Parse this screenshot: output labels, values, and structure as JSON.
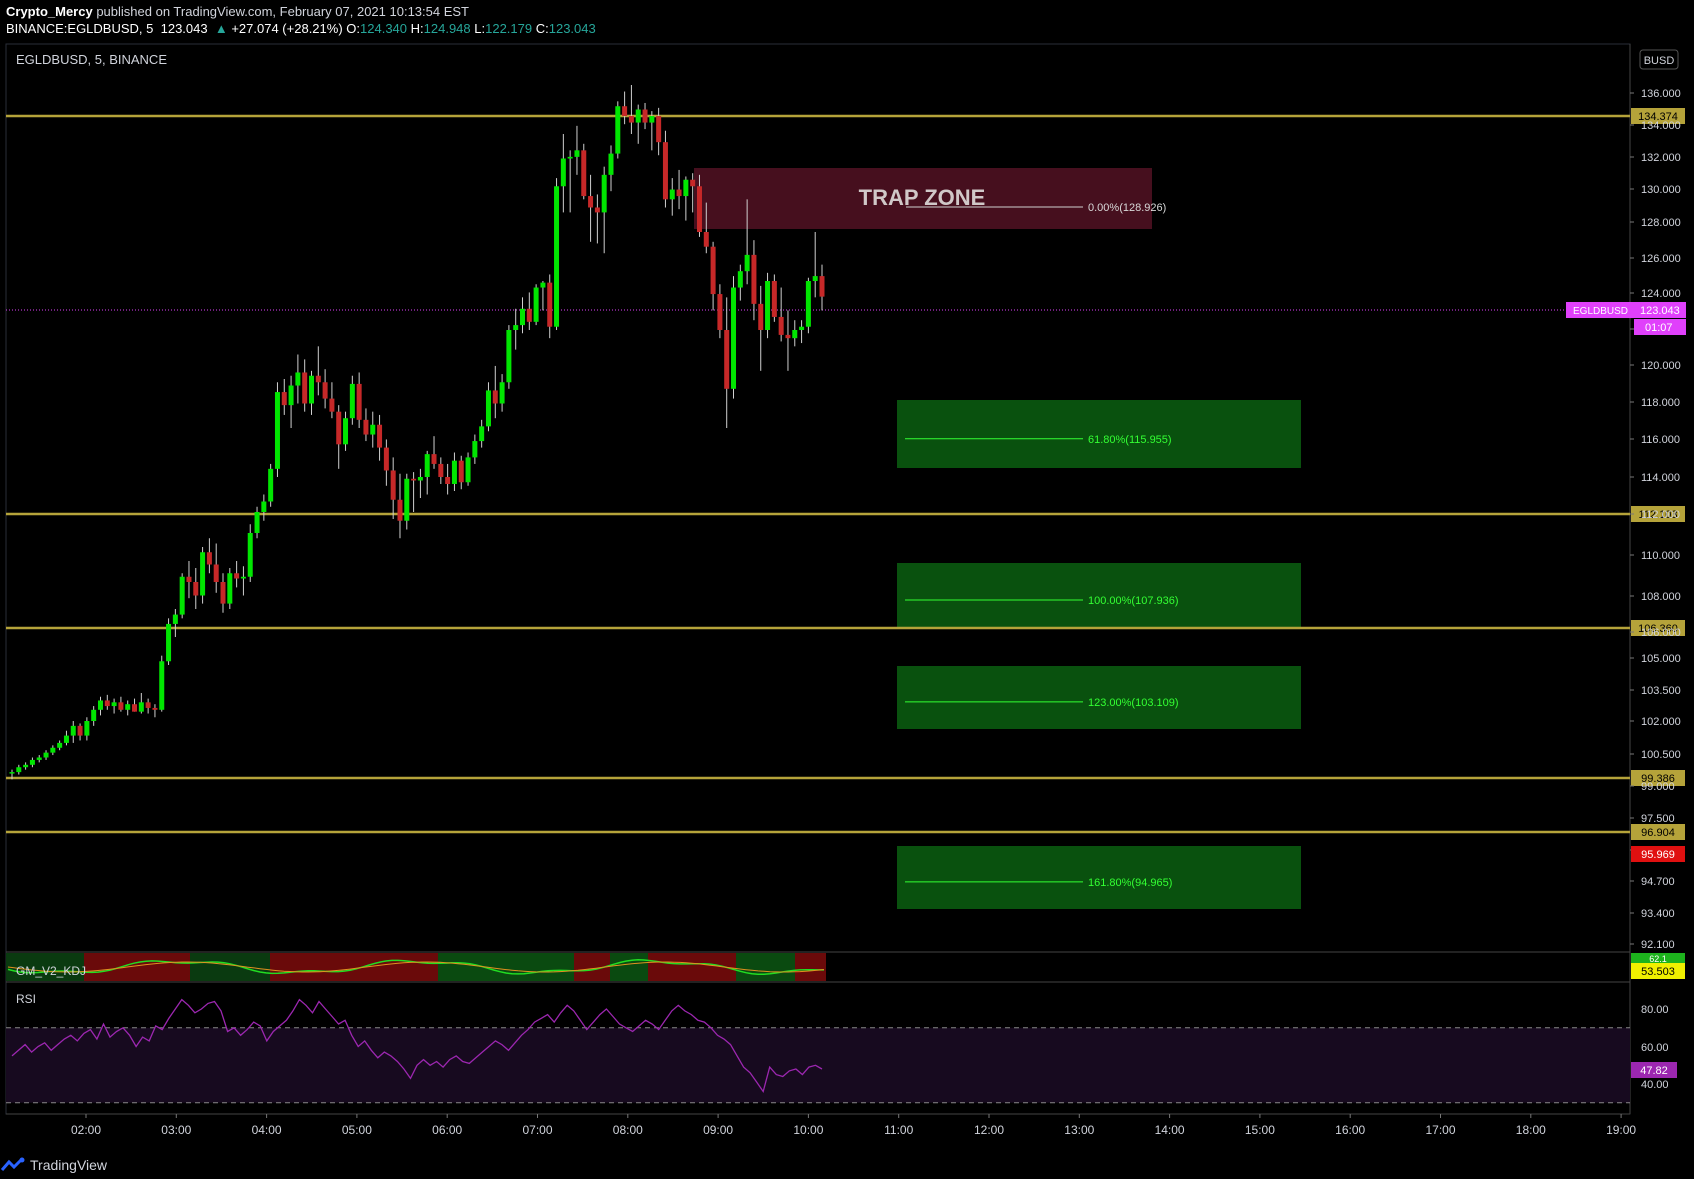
{
  "header": {
    "author": "Crypto_Mercy",
    "published_text": "published on TradingView.com, February 07, 2021 10:13:54 EST",
    "symbol_line": "BINANCE:EGLDBUSD, 5",
    "last": "123.043",
    "change": "+27.074 (+28.21%)",
    "o_label": "O:",
    "o_val": "124.340",
    "h_label": "H:",
    "h_val": "124.948",
    "l_label": "L:",
    "l_val": "122.179",
    "c_label": "C:",
    "c_val": "123.043"
  },
  "pane_title": "EGLDBUSD, 5, BINANCE",
  "currency_button": "BUSD",
  "footer": {
    "brand": "TradingView",
    "logo_icon": "tradingview-logo-icon"
  },
  "colors": {
    "background": "#000000",
    "up": "#00e600",
    "down": "#c62828",
    "level_line": "#b5a33a",
    "trap_zone": "#4a1020",
    "target_zone": "#0a5a10",
    "rsi": "#9c27b0",
    "last_price": "#e040fb"
  },
  "chart_data": [
    {
      "type": "candlestick",
      "title": "EGLDBUSD, 5, BINANCE",
      "x_ticks": [
        "02:00",
        "03:00",
        "04:00",
        "05:00",
        "06:00",
        "07:00",
        "08:00",
        "09:00",
        "10:00",
        "11:00",
        "12:00",
        "13:00",
        "14:00",
        "15:00",
        "16:00",
        "17:00",
        "18:00",
        "19:00"
      ],
      "y_ticks": [
        "136.000",
        "134.000",
        "132.000",
        "130.000",
        "128.000",
        "126.000",
        "124.000",
        "122.000",
        "120.000",
        "118.000",
        "116.000",
        "114.000",
        "112.000",
        "110.000",
        "108.000",
        "106.000",
        "105.000",
        "103.500",
        "102.000",
        "100.500",
        "99.000",
        "97.500",
        "96.000",
        "94.700",
        "93.400",
        "92.100"
      ],
      "last_price": {
        "label": "EGLDBUSD",
        "value": "123.043",
        "countdown": "01:07"
      },
      "horizontal_levels": [
        "134.374",
        "112.103",
        "106.360",
        "99.386",
        "96.904"
      ],
      "price_badge_red": "95.969",
      "zones": [
        {
          "name": "TRAP ZONE",
          "fib_label": "0.00%(128.926)",
          "kind": "trap"
        },
        {
          "fib_label": "61.80%(115.955)",
          "kind": "target"
        },
        {
          "fib_label": "100.00%(107.936)",
          "kind": "target"
        },
        {
          "fib_label": "123.00%(103.109)",
          "kind": "target"
        },
        {
          "fib_label": "161.80%(94.965)",
          "kind": "target"
        }
      ],
      "candles_approx": [
        [
          96.9,
          97.0,
          96.6,
          96.9
        ],
        [
          96.9,
          97.2,
          96.8,
          97.1
        ],
        [
          97.1,
          97.3,
          97.0,
          97.2
        ],
        [
          97.2,
          97.5,
          97.1,
          97.4
        ],
        [
          97.4,
          97.6,
          97.3,
          97.5
        ],
        [
          97.5,
          97.8,
          97.4,
          97.7
        ],
        [
          97.7,
          98.0,
          97.6,
          97.9
        ],
        [
          97.9,
          98.2,
          97.8,
          98.1
        ],
        [
          98.1,
          98.6,
          98.0,
          98.4
        ],
        [
          98.4,
          99.0,
          98.1,
          98.8
        ],
        [
          98.8,
          98.9,
          98.2,
          98.4
        ],
        [
          98.4,
          99.2,
          98.2,
          99.0
        ],
        [
          99.0,
          99.8,
          98.8,
          99.6
        ],
        [
          99.6,
          100.3,
          99.3,
          100.1
        ],
        [
          100.1,
          100.4,
          99.6,
          99.8
        ],
        [
          99.8,
          100.2,
          99.4,
          100.0
        ],
        [
          100.0,
          100.3,
          99.5,
          99.6
        ],
        [
          99.6,
          100.1,
          99.3,
          99.9
        ],
        [
          99.9,
          100.2,
          99.5,
          99.5
        ],
        [
          99.5,
          100.5,
          99.4,
          100.0
        ],
        [
          100.0,
          100.2,
          99.4,
          99.7
        ],
        [
          99.7,
          99.9,
          99.2,
          99.6
        ],
        [
          99.6,
          102.5,
          99.5,
          102.2
        ],
        [
          102.2,
          104.5,
          102.0,
          104.2
        ],
        [
          104.2,
          105.0,
          103.5,
          104.7
        ],
        [
          104.7,
          106.5,
          104.5,
          106.3
        ],
        [
          106.3,
          107.2,
          105.4,
          106.0
        ],
        [
          106.0,
          106.8,
          105.0,
          105.5
        ],
        [
          105.5,
          108.0,
          105.2,
          107.7
        ],
        [
          107.7,
          108.5,
          106.5,
          107.0
        ],
        [
          107.0,
          108.2,
          105.6,
          106.0
        ],
        [
          106.0,
          106.5,
          104.8,
          105.2
        ],
        [
          105.2,
          106.8,
          105.0,
          106.5
        ],
        [
          106.5,
          107.2,
          105.8,
          106.2
        ],
        [
          106.2,
          106.9,
          105.5,
          106.3
        ],
        [
          106.3,
          109.3,
          106.0,
          108.8
        ],
        [
          108.8,
          110.3,
          108.5,
          110.0
        ],
        [
          110.0,
          111.0,
          109.5,
          110.6
        ],
        [
          110.6,
          112.8,
          110.3,
          112.5
        ],
        [
          112.5,
          117.8,
          112.0,
          117.2
        ],
        [
          117.2,
          118.0,
          115.8,
          116.4
        ],
        [
          116.4,
          118.2,
          115.0,
          117.6
        ],
        [
          117.6,
          119.5,
          116.5,
          118.4
        ],
        [
          118.4,
          119.2,
          116.0,
          116.5
        ],
        [
          116.5,
          118.5,
          115.8,
          118.2
        ],
        [
          118.2,
          120.0,
          117.0,
          117.8
        ],
        [
          117.8,
          118.6,
          116.2,
          116.8
        ],
        [
          116.8,
          117.8,
          115.6,
          116.0
        ],
        [
          116.0,
          116.4,
          112.5,
          114.0
        ],
        [
          114.0,
          116.0,
          113.6,
          115.6
        ],
        [
          115.6,
          118.2,
          115.2,
          117.7
        ],
        [
          117.7,
          118.4,
          115.0,
          115.5
        ],
        [
          115.5,
          116.2,
          114.2,
          114.6
        ],
        [
          114.6,
          116.0,
          113.8,
          115.2
        ],
        [
          115.2,
          115.8,
          113.0,
          113.8
        ],
        [
          113.8,
          114.3,
          111.5,
          112.4
        ],
        [
          112.4,
          113.2,
          109.6,
          110.7
        ],
        [
          110.7,
          112.2,
          108.5,
          109.5
        ],
        [
          109.5,
          112.2,
          109.0,
          111.9
        ],
        [
          111.9,
          112.3,
          110.0,
          111.8
        ],
        [
          111.8,
          112.5,
          110.8,
          112.0
        ],
        [
          112.0,
          113.6,
          111.0,
          113.4
        ],
        [
          113.4,
          114.5,
          112.5,
          112.8
        ],
        [
          112.8,
          113.2,
          111.6,
          112.0
        ],
        [
          112.0,
          112.8,
          111.0,
          111.6
        ],
        [
          111.6,
          113.5,
          111.2,
          113.0
        ],
        [
          113.0,
          113.3,
          111.3,
          111.7
        ],
        [
          111.7,
          113.5,
          111.5,
          113.2
        ],
        [
          113.2,
          114.6,
          112.8,
          114.2
        ],
        [
          114.2,
          115.5,
          113.8,
          115.1
        ],
        [
          115.1,
          117.8,
          114.8,
          117.3
        ],
        [
          117.3,
          118.8,
          115.6,
          116.5
        ],
        [
          116.5,
          118.3,
          116.0,
          117.8
        ],
        [
          117.8,
          121.3,
          117.4,
          121.0
        ],
        [
          121.0,
          122.3,
          119.8,
          121.3
        ],
        [
          121.3,
          123.0,
          120.8,
          122.3
        ],
        [
          122.3,
          123.3,
          121.0,
          121.5
        ],
        [
          121.5,
          123.8,
          121.3,
          123.6
        ],
        [
          123.6,
          124.0,
          122.2,
          123.9
        ],
        [
          123.9,
          124.4,
          120.5,
          121.2
        ],
        [
          121.2,
          130.3,
          121.0,
          129.8
        ],
        [
          129.8,
          133.0,
          128.2,
          131.5
        ],
        [
          131.5,
          132.0,
          128.2,
          131.6
        ],
        [
          131.6,
          133.5,
          130.5,
          132.0
        ],
        [
          132.0,
          132.4,
          129.0,
          129.2
        ],
        [
          129.2,
          130.5,
          126.4,
          128.5
        ],
        [
          128.5,
          129.3,
          126.3,
          128.2
        ],
        [
          128.2,
          131.0,
          125.7,
          130.5
        ],
        [
          130.5,
          132.3,
          129.5,
          131.8
        ],
        [
          131.8,
          135.0,
          131.5,
          134.7
        ],
        [
          134.7,
          135.6,
          133.6,
          134.1
        ],
        [
          134.1,
          136.0,
          133.0,
          133.7
        ],
        [
          133.7,
          134.8,
          132.4,
          134.5
        ],
        [
          134.5,
          134.9,
          133.3,
          133.7
        ],
        [
          133.7,
          134.4,
          132.0,
          134.1
        ],
        [
          134.1,
          134.6,
          131.7,
          132.5
        ],
        [
          132.5,
          133.2,
          128.5,
          129.0
        ],
        [
          129.0,
          130.3,
          128.0,
          129.6
        ],
        [
          129.6,
          130.8,
          128.4,
          129.2
        ],
        [
          129.2,
          130.4,
          127.7,
          130.2
        ],
        [
          130.2,
          130.6,
          128.2,
          129.8
        ],
        [
          129.8,
          130.5,
          126.7,
          127.0
        ],
        [
          127.0,
          128.8,
          125.7,
          126.1
        ],
        [
          126.1,
          126.4,
          122.2,
          123.2
        ],
        [
          123.2,
          123.8,
          120.5,
          121.0
        ],
        [
          121.0,
          123.0,
          115.0,
          117.4
        ],
        [
          117.4,
          124.3,
          116.8,
          123.6
        ],
        [
          123.6,
          125.0,
          122.8,
          124.6
        ],
        [
          124.6,
          129.0,
          123.8,
          125.6
        ],
        [
          125.6,
          126.5,
          121.6,
          122.6
        ],
        [
          122.6,
          123.7,
          118.5,
          121.0
        ],
        [
          121.0,
          124.5,
          120.5,
          124.0
        ],
        [
          124.0,
          124.4,
          121.5,
          121.8
        ],
        [
          121.8,
          123.6,
          120.3,
          120.7
        ],
        [
          120.7,
          122.2,
          118.5,
          120.5
        ],
        [
          120.5,
          121.6,
          120.0,
          121.0
        ],
        [
          121.0,
          121.6,
          120.2,
          121.2
        ],
        [
          121.2,
          124.2,
          120.8,
          124.0
        ],
        [
          124.0,
          127.0,
          123.0,
          124.3
        ],
        [
          124.3,
          125.0,
          122.2,
          123.043
        ]
      ]
    },
    {
      "type": "line",
      "title": "GM_V2_KDJ",
      "value_badge": "53.503",
      "top_badge": "62.1"
    },
    {
      "type": "line",
      "title": "RSI",
      "y_ticks": [
        "80.00",
        "60.00",
        "40.00"
      ],
      "value_badge": "47.82",
      "series_approx": [
        55,
        58,
        61,
        57,
        60,
        62,
        58,
        61,
        64,
        66,
        63,
        67,
        69,
        64,
        72,
        65,
        68,
        70,
        66,
        60,
        65,
        63,
        71,
        69,
        75,
        80,
        85,
        82,
        78,
        80,
        83,
        84,
        79,
        68,
        70,
        66,
        69,
        73,
        71,
        63,
        68,
        71,
        74,
        79,
        85,
        82,
        78,
        84,
        80,
        76,
        72,
        74,
        66,
        60,
        63,
        58,
        54,
        57,
        55,
        52,
        48,
        43,
        50,
        53,
        50,
        52,
        49,
        53,
        55,
        52,
        51,
        54,
        57,
        60,
        63,
        61,
        58,
        62,
        66,
        69,
        73,
        75,
        77,
        73,
        78,
        82,
        79,
        74,
        69,
        73,
        77,
        80,
        76,
        72,
        70,
        68,
        71,
        74,
        72,
        69,
        74,
        79,
        82,
        79,
        77,
        74,
        73,
        70,
        66,
        64,
        61,
        55,
        49,
        46,
        41,
        36,
        49,
        45,
        44,
        47,
        48,
        45,
        49,
        50,
        48
      ]
    }
  ]
}
